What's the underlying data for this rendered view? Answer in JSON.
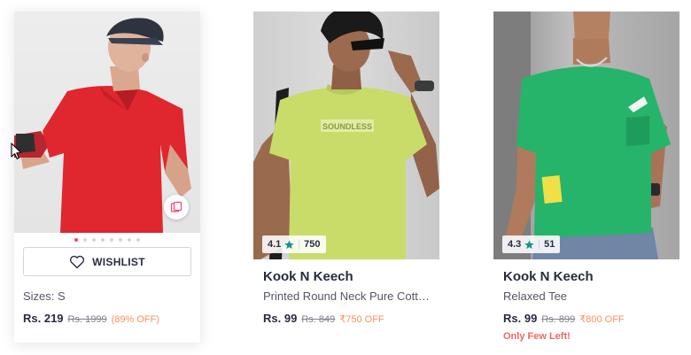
{
  "products": [
    {
      "sizes_label": "Sizes: S",
      "price": "Rs. 219",
      "mrp": "Rs. 1999",
      "discount": "(89% OFF)",
      "wishlist_label": "WISHLIST",
      "icons": {
        "wishlist": "heart-icon",
        "similar": "view-similar-icon"
      },
      "image_count": 8,
      "active_image_index": 0
    },
    {
      "rating": "4.1",
      "rating_count": "750",
      "brand": "Kook N Keech",
      "name": "Printed Round Neck Pure Cotton T-shirt",
      "price": "Rs. 99",
      "mrp": "Rs. 849",
      "discount": "₹750 OFF",
      "icons": {
        "rating": "star-icon"
      },
      "print_text": "SOUNDLESS"
    },
    {
      "rating": "4.3",
      "rating_count": "51",
      "brand": "Kook N Keech",
      "name": "Relaxed Tee",
      "price": "Rs. 99",
      "mrp": "Rs. 899",
      "discount": "₹800 OFF",
      "stock_note": "Only Few Left!",
      "icons": {
        "rating": "star-icon"
      }
    }
  ],
  "colors": {
    "accent": "#ff3f6c",
    "discount": "#ff905a",
    "rating_star": "#14958f",
    "stock_warning": "#f16565",
    "text_primary": "#282c3f",
    "text_secondary": "#535766"
  }
}
